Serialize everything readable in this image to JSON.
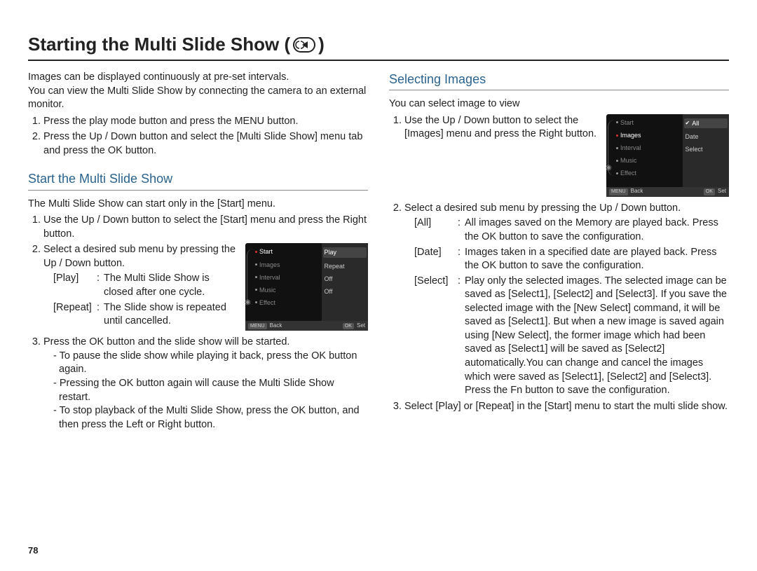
{
  "title_prefix": "Starting the Multi Slide Show (",
  "title_suffix": " )",
  "intro_p1": "Images can be displayed continuously at pre-set intervals.",
  "intro_p2": "You can view the Multi Slide Show by connecting the camera to an external monitor.",
  "intro_steps": [
    "Press the play mode button and press the MENU button.",
    "Press the Up / Down button and select the [Multi Slide Show] menu tab and press the OK button."
  ],
  "left": {
    "section_title": "Start the Multi Slide Show",
    "lead": "The Multi Slide Show can start only in the [Start] menu.",
    "step1": "Use the Up / Down button  to select the [Start] menu and press the Right button.",
    "step2": "Select a desired sub menu by pressing the Up / Down button.",
    "def_play_k": "[Play]",
    "def_play_v": "The Multi Slide Show is closed after one cycle.",
    "def_repeat_k": "[Repeat]",
    "def_repeat_v": "The Slide show is repeated until cancelled.",
    "step3": "Press the OK button and the slide show will be started.",
    "dash1": "To pause the slide show while playing it back, press the OK button again.",
    "dash2": "Pressing the OK button again will cause the Multi Slide Show restart.",
    "dash3": "To stop playback of the Multi Slide Show, press the OK button, and then press the Left or Right button."
  },
  "right": {
    "section_title": "Selecting Images",
    "lead": "You can select image to view",
    "step1": "Use the Up / Down button to select the [Images] menu and press the Right button.",
    "step2": "Select a desired sub menu by pressing the Up / Down button.",
    "def_all_k": "[All]",
    "def_all_v": "All images saved on the Memory are played back. Press the OK button to save the configuration.",
    "def_date_k": "[Date]",
    "def_date_v": "Images taken in a specified date are played back. Press the OK button to save the configuration.",
    "def_select_k": "[Select]",
    "def_select_v": "Play only the selected images. The selected image can be saved as [Select1], [Select2] and [Select3]. If you save the selected image with the [New Select] command, it will be saved as [Select1]. But when a new image is saved again using [New Select], the former image which had been saved as [Select1] will be saved as [Select2] automatically.You can change and cancel the images which were saved as [Select1], [Select2] and [Select3]. Press the Fn button to save the configuration.",
    "step3": "Select [Play] or [Repeat] in the [Start] menu to start the multi slide show."
  },
  "screen1": {
    "left_items": [
      "Start",
      "Images",
      "Interval",
      "Music",
      "Effect"
    ],
    "right_items": [
      "Play",
      "Repeat",
      "Off",
      "Off"
    ],
    "footer_left_btn": "MENU",
    "footer_left": "Back",
    "footer_right_btn": "OK",
    "footer_right": "Set"
  },
  "screen2": {
    "left_items": [
      "Start",
      "Images",
      "Interval",
      "Music",
      "Effect"
    ],
    "right_items": [
      "All",
      "Date",
      "Select"
    ],
    "footer_left_btn": "MENU",
    "footer_left": "Back",
    "footer_right_btn": "OK",
    "footer_right": "Set"
  },
  "page_number": "78"
}
